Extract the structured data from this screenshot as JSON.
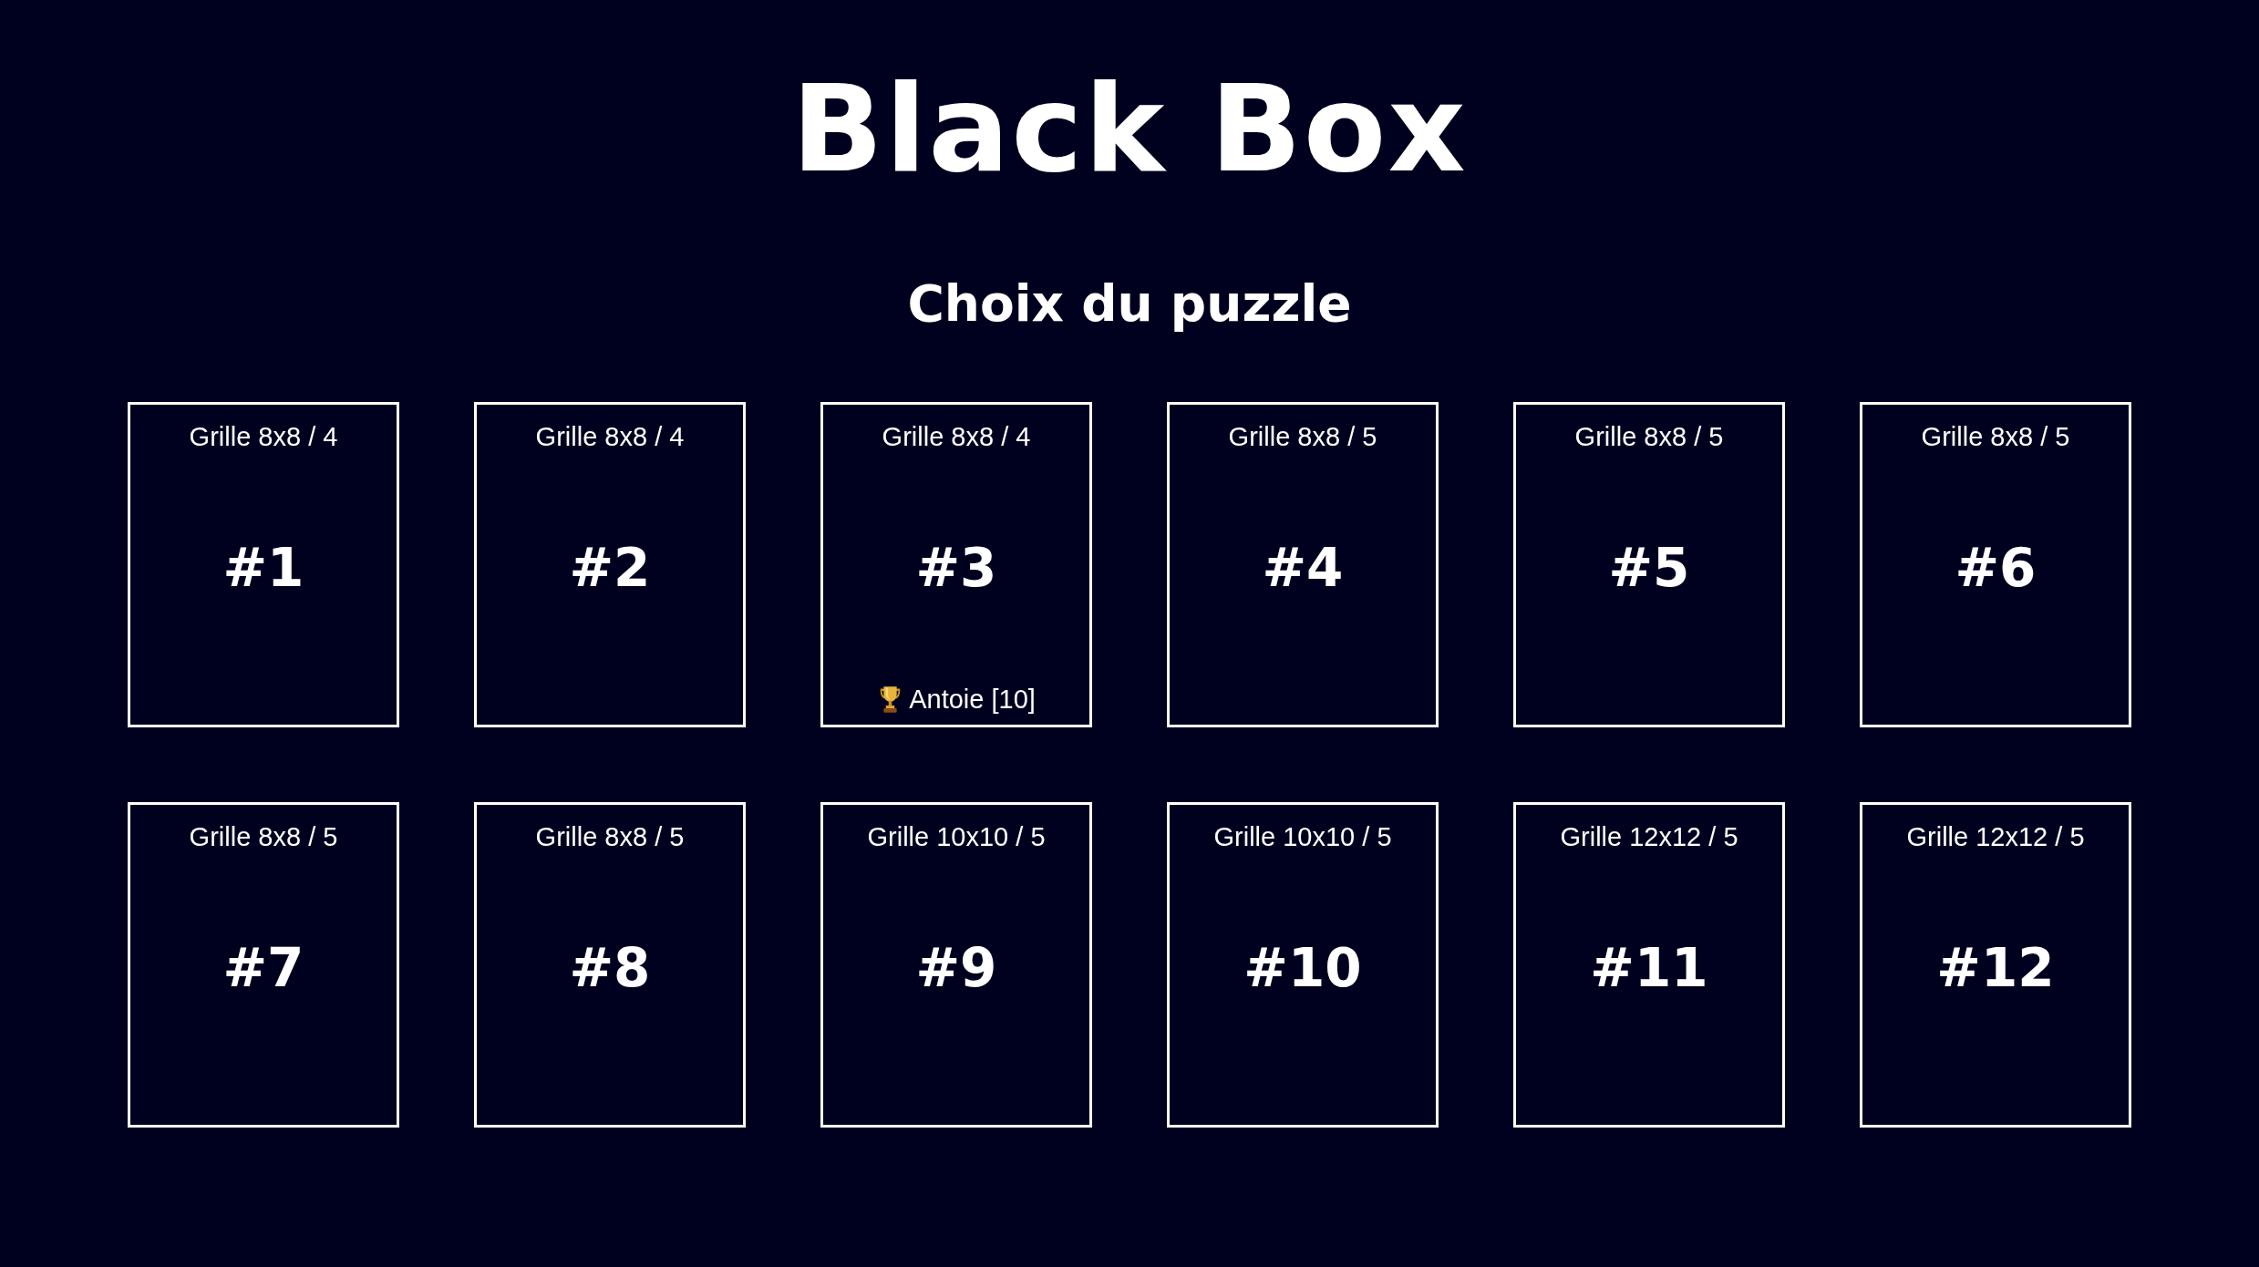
{
  "title": "Black Box",
  "subtitle": "Choix du puzzle",
  "puzzles": [
    {
      "grid": "Grille 8x8 / 4",
      "number": "#1"
    },
    {
      "grid": "Grille 8x8 / 4",
      "number": "#2"
    },
    {
      "grid": "Grille 8x8 / 4",
      "number": "#3",
      "record": "Antoie [10]"
    },
    {
      "grid": "Grille 8x8 / 5",
      "number": "#4"
    },
    {
      "grid": "Grille 8x8 / 5",
      "number": "#5"
    },
    {
      "grid": "Grille 8x8 / 5",
      "number": "#6"
    },
    {
      "grid": "Grille 8x8 / 5",
      "number": "#7"
    },
    {
      "grid": "Grille 8x8 / 5",
      "number": "#8"
    },
    {
      "grid": "Grille 10x10 / 5",
      "number": "#9"
    },
    {
      "grid": "Grille 10x10 / 5",
      "number": "#10"
    },
    {
      "grid": "Grille 12x12 / 5",
      "number": "#11"
    },
    {
      "grid": "Grille 12x12 / 5",
      "number": "#12"
    }
  ]
}
